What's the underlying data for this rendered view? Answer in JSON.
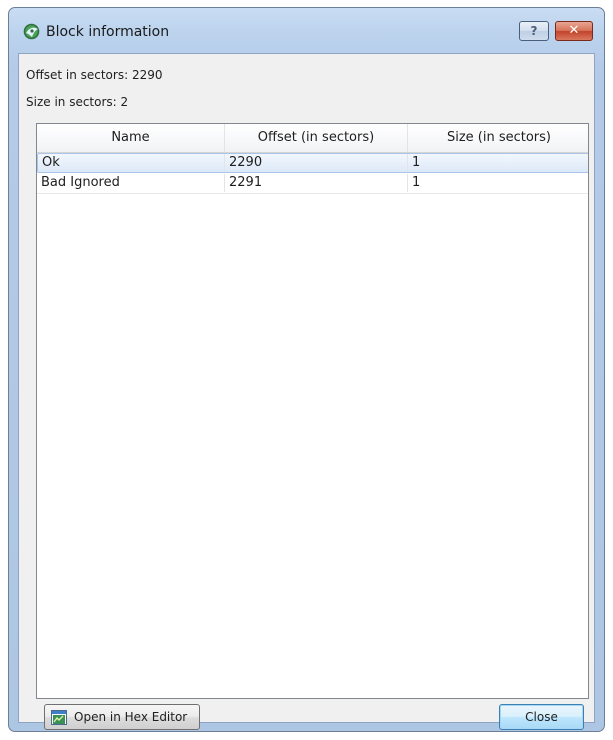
{
  "window": {
    "title": "Block information",
    "help_label": "?",
    "close_label": "✕"
  },
  "info": {
    "offset_text": "Offset in sectors: 2290",
    "size_text": "Size in sectors: 2"
  },
  "table": {
    "columns": [
      "Name",
      "Offset (in sectors)",
      "Size (in sectors)"
    ],
    "rows": [
      {
        "name": "Ok",
        "offset": "2290",
        "size": "1",
        "selected": true
      },
      {
        "name": "Bad Ignored",
        "offset": "2291",
        "size": "1",
        "selected": false
      }
    ]
  },
  "buttons": {
    "hex_editor": "Open in Hex Editor",
    "close": "Close"
  },
  "colors": {
    "title_bar": "#bcd3ee",
    "selection": "#dde9f8",
    "close_button": "#c2432a"
  }
}
